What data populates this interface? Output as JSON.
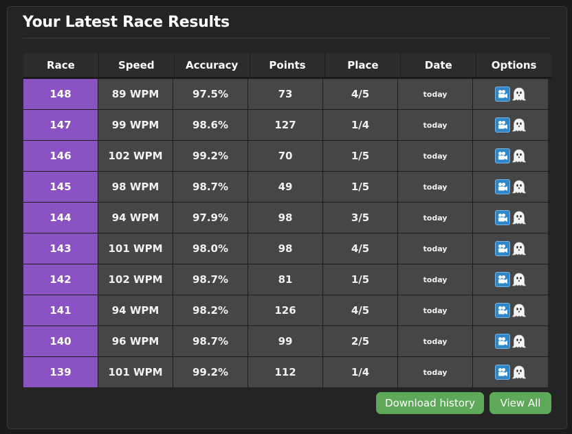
{
  "panel": {
    "title": "Your Latest Race Results"
  },
  "table": {
    "headers": [
      "Race",
      "Speed",
      "Accuracy",
      "Points",
      "Place",
      "Date",
      "Options"
    ],
    "rows": [
      {
        "race": "148",
        "speed": "89 WPM",
        "accuracy": "97.5%",
        "points": "73",
        "place": "4/5",
        "date": "today"
      },
      {
        "race": "147",
        "speed": "99 WPM",
        "accuracy": "98.6%",
        "points": "127",
        "place": "1/4",
        "date": "today"
      },
      {
        "race": "146",
        "speed": "102 WPM",
        "accuracy": "99.2%",
        "points": "70",
        "place": "1/5",
        "date": "today"
      },
      {
        "race": "145",
        "speed": "98 WPM",
        "accuracy": "98.7%",
        "points": "49",
        "place": "1/5",
        "date": "today"
      },
      {
        "race": "144",
        "speed": "94 WPM",
        "accuracy": "97.9%",
        "points": "98",
        "place": "3/5",
        "date": "today"
      },
      {
        "race": "143",
        "speed": "101 WPM",
        "accuracy": "98.0%",
        "points": "98",
        "place": "4/5",
        "date": "today"
      },
      {
        "race": "142",
        "speed": "102 WPM",
        "accuracy": "98.7%",
        "points": "81",
        "place": "1/5",
        "date": "today"
      },
      {
        "race": "141",
        "speed": "94 WPM",
        "accuracy": "98.2%",
        "points": "126",
        "place": "4/5",
        "date": "today"
      },
      {
        "race": "140",
        "speed": "96 WPM",
        "accuracy": "98.7%",
        "points": "99",
        "place": "2/5",
        "date": "today"
      },
      {
        "race": "139",
        "speed": "101 WPM",
        "accuracy": "99.2%",
        "points": "112",
        "place": "1/4",
        "date": "today"
      }
    ],
    "options_icons": [
      "replay-camera-icon",
      "ghost-icon"
    ]
  },
  "buttons": {
    "download_label": "Download history",
    "view_all_label": "View All"
  },
  "colors": {
    "race_cell": "#8a52c2",
    "button_green": "#5ea859",
    "replay_blue": "#2f86c8"
  }
}
